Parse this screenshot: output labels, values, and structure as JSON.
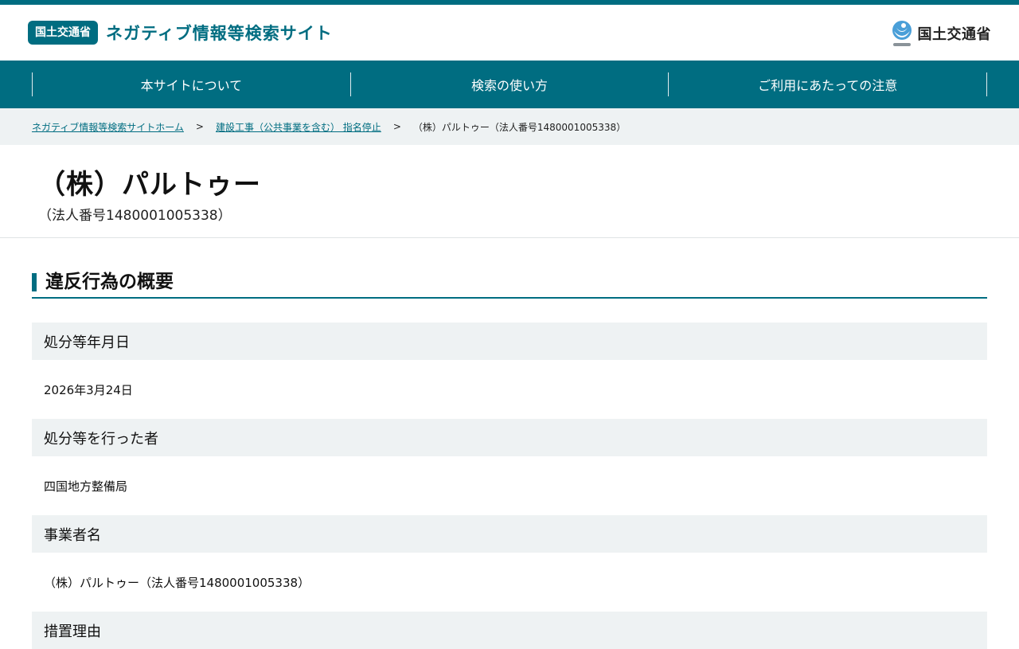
{
  "header": {
    "badge": "国土交通省",
    "site_title": "ネガティブ情報等検索サイト",
    "logo_text": "国土交通省"
  },
  "nav": {
    "items": [
      {
        "label": "本サイトについて"
      },
      {
        "label": "検索の使い方"
      },
      {
        "label": "ご利用にあたっての注意"
      }
    ]
  },
  "breadcrumb": {
    "home": "ネガティブ情報等検索サイトホーム",
    "category": "建設工事（公共事業を含む） 指名停止",
    "current": "（株）パルトゥー（法人番号1480001005338）",
    "separator": ">"
  },
  "page": {
    "company_name": "（株）パルトゥー",
    "corporate_number": "（法人番号1480001005338）"
  },
  "section": {
    "title": "違反行為の概要",
    "rows": [
      {
        "label": "処分等年月日",
        "value": "2026年3月24日"
      },
      {
        "label": "処分等を行った者",
        "value": "四国地方整備局"
      },
      {
        "label": "事業者名",
        "value": "（株）パルトゥー（法人番号1480001005338）"
      },
      {
        "label": "措置理由",
        "value": ""
      }
    ]
  },
  "colors": {
    "brand": "#006d81",
    "row_background": "#eef2f3"
  }
}
